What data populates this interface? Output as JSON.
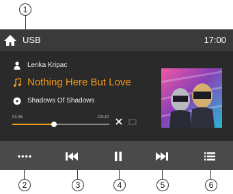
{
  "topbar": {
    "source": "USB",
    "clock": "17:00",
    "home_icon": "home-icon"
  },
  "track": {
    "artist": "Lenka Kripac",
    "title": "Nothing Here But Love",
    "album": "Shadows Of Shadows"
  },
  "playback": {
    "elapsed": "01:15",
    "remaining": "-03:10",
    "progress_fraction": 0.43
  },
  "controls": {
    "more": "more-options-icon",
    "previous": "previous-track-icon",
    "pause": "pause-icon",
    "next": "next-track-icon",
    "list": "track-list-icon",
    "shuffle": "shuffle-icon",
    "repeat": "repeat-icon"
  },
  "callouts": [
    "1",
    "2",
    "3",
    "4",
    "5",
    "6"
  ],
  "colors": {
    "accent": "#f39a1b",
    "screen_bg": "#2e2e2e",
    "bar_bg": "#4a4a4a"
  }
}
